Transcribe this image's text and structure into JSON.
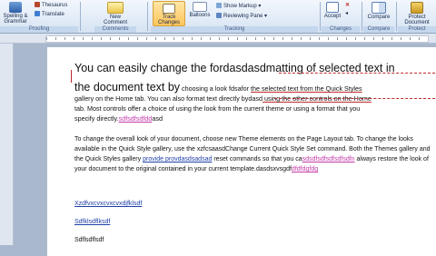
{
  "ribbon": {
    "proofing": {
      "spelling": "Spelling &",
      "grammar": "Grammar",
      "thesaurus": "Thesaurus",
      "translate": "Translate",
      "label": "Proofing"
    },
    "comments": {
      "new": "New",
      "comment": "Comment",
      "label": "Comments"
    },
    "tracking": {
      "track": "Track",
      "changes": "Changes",
      "balloons": "Balloons",
      "show_markup": "Show Markup",
      "reviewing_pane": "Reviewing Pane",
      "label": "Tracking"
    },
    "changes": {
      "accept": "Accept",
      "label": "Changes"
    },
    "compare": {
      "compare": "Compare",
      "label": "Compare"
    },
    "protect": {
      "protect": "Protect",
      "document": "Document",
      "label": "Protect"
    }
  },
  "document": {
    "p1_a": "You can easily change the fordasdasdmatting of selected text in",
    "p1_b": "the document text by",
    "p1_c": " choosing a look fdsafor ",
    "p1_d": "the selected text from the Quick Styles",
    "p1_e": "gallery on the Home tab. You can also format text directly bydasd",
    "p1_f": " using the other controls on the Home",
    "p1_g": "tab. Most controls offer a choice of using the look from the current theme or using a format that you",
    "p1_h": "specify directly.",
    "p1_i": "sdfsdfsdfdd",
    "p1_j": "asd",
    "p2_a": "To change the overall look of your document, choose new Theme elements on the Page Layout tab. To change the looks available in the Quick Style gallery, use the xzfcsaasdChange Current Quick Style Set command. Both the Themes gallery and the Quick Styles gallery ",
    "p2_b": "provide provdasdsadsad",
    "p2_c": " reset commands so that you ca",
    "p2_d": "sdsdfsdfsdfsdfsdfn",
    "p2_e": " always restore the look of your document to the original contained in your current template.dasdsxvsgdf",
    "p2_f": "dfdfdgfdg",
    "line1": "Xzdfvxcvxcvxcvxdjfklsdf",
    "line2": "Sdfklsdflksdf",
    "line3": "Sdflsdflsdf"
  },
  "colors": {
    "accent_red": "#c0282c",
    "accent_magenta": "#c23aa7",
    "link": "#1f3fa8",
    "ribbon": "#d6e3f3"
  }
}
